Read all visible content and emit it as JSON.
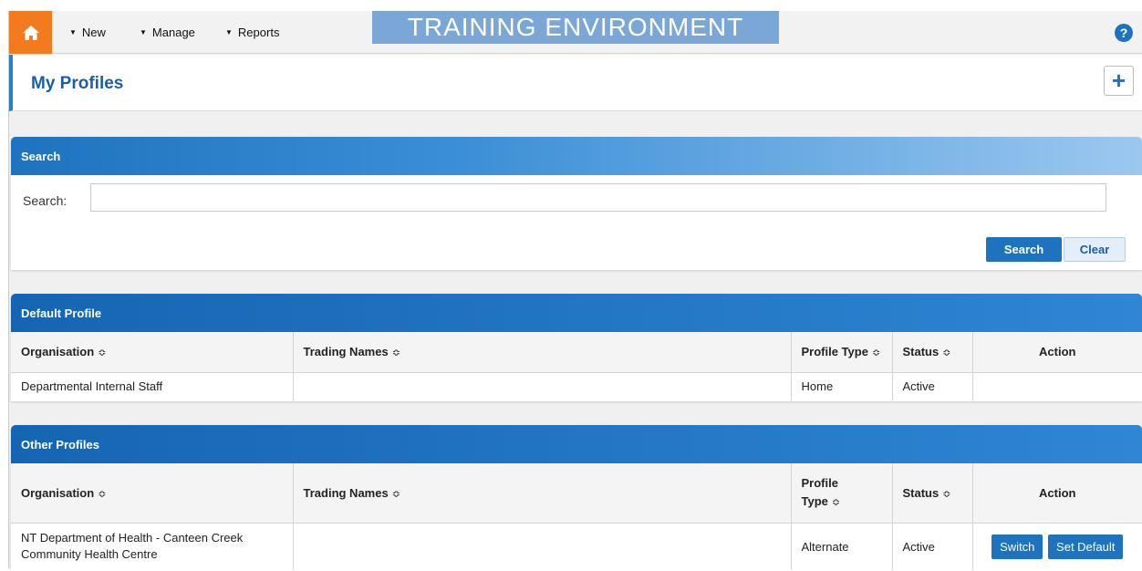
{
  "nav": {
    "new_label": "New",
    "manage_label": "Manage",
    "reports_label": "Reports",
    "banner": "TRAINING ENVIRONMENT",
    "help_icon": "?"
  },
  "header": {
    "title": "My Profiles",
    "add_icon": "+"
  },
  "search_panel": {
    "title": "Search",
    "label": "Search:",
    "value": "",
    "search_button": "Search",
    "clear_button": "Clear"
  },
  "default_profile": {
    "title": "Default Profile",
    "columns": {
      "organisation": "Organisation",
      "trading_names": "Trading Names",
      "profile_type": "Profile Type",
      "status": "Status",
      "action": "Action"
    },
    "row": {
      "organisation": "Departmental Internal Staff",
      "trading_names": "",
      "profile_type": "Home",
      "status": "Active"
    }
  },
  "other_profiles": {
    "title": "Other Profiles",
    "columns": {
      "organisation": "Organisation",
      "trading_names": "Trading Names",
      "profile_type_line1": "Profile",
      "profile_type_line2": "Type",
      "status": "Status",
      "action": "Action"
    },
    "row": {
      "organisation_line1": "NT Department of Health - Canteen Creek",
      "organisation_line2": "Community Health Centre",
      "trading_names": "",
      "profile_type": "Alternate",
      "status": "Active",
      "switch_button": "Switch",
      "set_default_button": "Set Default"
    }
  },
  "colors": {
    "accent": "#1e73be",
    "home": "#f47a20",
    "banner": "#7aa7d6"
  }
}
